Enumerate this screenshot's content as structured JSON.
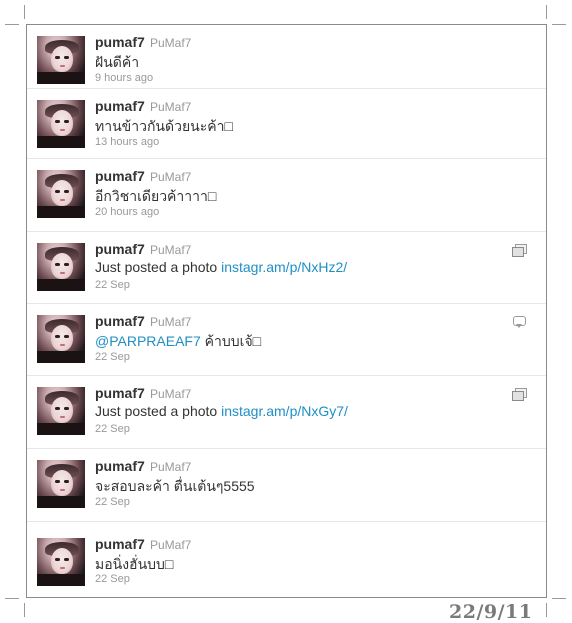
{
  "tweets": [
    {
      "name": "pumaf7",
      "handle": "PuMaf7",
      "text": "ฝันดีค้า",
      "time": "9 hours ago",
      "icon": ""
    },
    {
      "name": "pumaf7",
      "handle": "PuMaf7",
      "text": "ทานข้าวกันด้วยนะค้า□",
      "time": "13 hours ago",
      "icon": ""
    },
    {
      "name": "pumaf7",
      "handle": "PuMaf7",
      "text": "อีกวิชาเดียวค้าาาา□",
      "time": "20 hours ago",
      "icon": ""
    },
    {
      "name": "pumaf7",
      "handle": "PuMaf7",
      "text": "Just posted a photo ",
      "link": "instagr.am/p/NxHz2/",
      "time": "22 Sep",
      "icon": "photo-icon"
    },
    {
      "name": "pumaf7",
      "handle": "PuMaf7",
      "mention": "@PARPRAEAF7",
      "text": " ค้าบบเจ้□",
      "time": "22 Sep",
      "icon": "reply-icon"
    },
    {
      "name": "pumaf7",
      "handle": "PuMaf7",
      "text": "Just posted a photo ",
      "link": "instagr.am/p/NxGy7/",
      "time": "22 Sep",
      "icon": "photo-icon"
    },
    {
      "name": "pumaf7",
      "handle": "PuMaf7",
      "text": "จะสอบละค้า ตื่นเต้นๆ5555",
      "time": "22 Sep",
      "icon": ""
    },
    {
      "name": "pumaf7",
      "handle": "PuMaf7",
      "text": "มอนิ่งฮั่นบบ□",
      "time": "22 Sep",
      "icon": ""
    }
  ],
  "stamp": "22/9/11",
  "colors": {
    "link": "#1f8fc4",
    "name": "#333333",
    "meta": "#999999"
  }
}
